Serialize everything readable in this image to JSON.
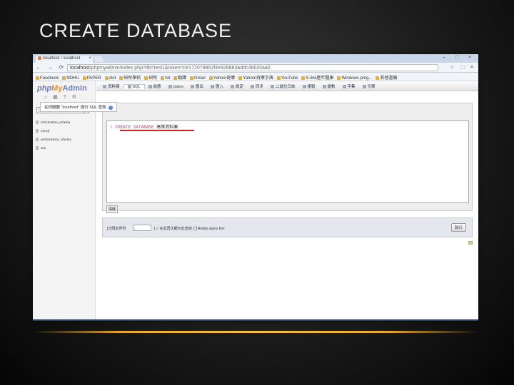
{
  "slide": {
    "title": "CREATE DATABASE"
  },
  "browser": {
    "tab_title": "localhost / localhost",
    "tab_close": "×",
    "window_buttons": "– □ ×",
    "nav_buttons": "← → ⟳",
    "url_host": "localhost",
    "url_path": "/phpmyadmin/index.php?db=test1&token=ce172079862f4e926883addc4b633aa0",
    "address_icons": "☆ ⬚ ≡",
    "bookmarks": [
      "Facebook",
      "NDHU",
      "PAPER",
      "stut",
      "研所學校",
      "研所",
      "hd",
      "翻譯",
      "Gmail",
      "Yahoo!奇摩",
      "Yahoo!奇摩字典",
      "YouTube",
      "S-link歷年題庫",
      "Windows prog...",
      "其他書籤"
    ]
  },
  "pma": {
    "logo": {
      "php": "php",
      "my": "My",
      "admin": "Admin"
    },
    "side_icons": "⌂ ▦ ? ⚙",
    "db_select": "(資料資料庫)...",
    "db_select_arrow": "▾",
    "databases": [
      "information_schema",
      "mysql",
      "performance_schema",
      "test"
    ],
    "menu": [
      "資料庫",
      "SQL",
      "狀態",
      "Users",
      "匯出",
      "匯入",
      "設定",
      "同步",
      "二進位日誌",
      "複製",
      "變數",
      "字集",
      "引擎"
    ],
    "legend": "在伺服器 \"localhost\" 運行 SQL 查詢",
    "legend_help": "?",
    "sql": {
      "line_no": "1",
      "keyword": "CREATE DATABASE",
      "comment": "高等資料庫"
    },
    "clear_label": "清除",
    "delimiter_label": "[分隔定界符",
    "delimiter_value": ";",
    "rerun_label": "] ✓ 在此再次顯示此查詢",
    "retain_label": "Retain query box",
    "go_label": "執行"
  }
}
